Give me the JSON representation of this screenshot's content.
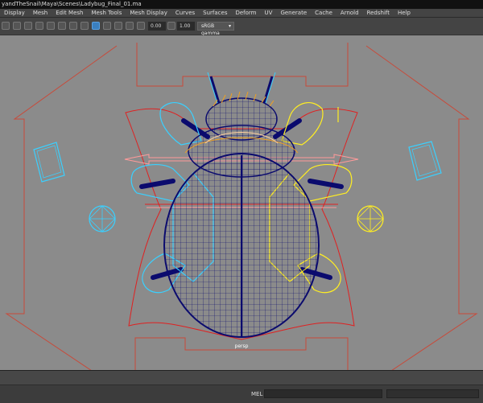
{
  "window": {
    "title": "yandTheSnail\\Maya\\Scenes\\Ladybug_Final_01.ma"
  },
  "menubar": {
    "items": [
      "Display",
      "Mesh",
      "Edit Mesh",
      "Mesh Tools",
      "Mesh Display",
      "Curves",
      "Surfaces",
      "Deform",
      "UV",
      "Generate",
      "Cache",
      "Arnold",
      "Redshift",
      "Help"
    ]
  },
  "toolbar": {
    "field_a": "0.00",
    "field_b": "1.00",
    "colorspace": "sRGB gamma"
  },
  "viewport": {
    "camera": "persp"
  },
  "command_line": {
    "label": "MEL"
  },
  "colors": {
    "viewport_bg": "#8b8b8b",
    "mesh_wire": "#0b0b6e",
    "control_red": "#e02020",
    "control_cyan": "#3ad0ff",
    "control_yellow": "#ffee22"
  }
}
